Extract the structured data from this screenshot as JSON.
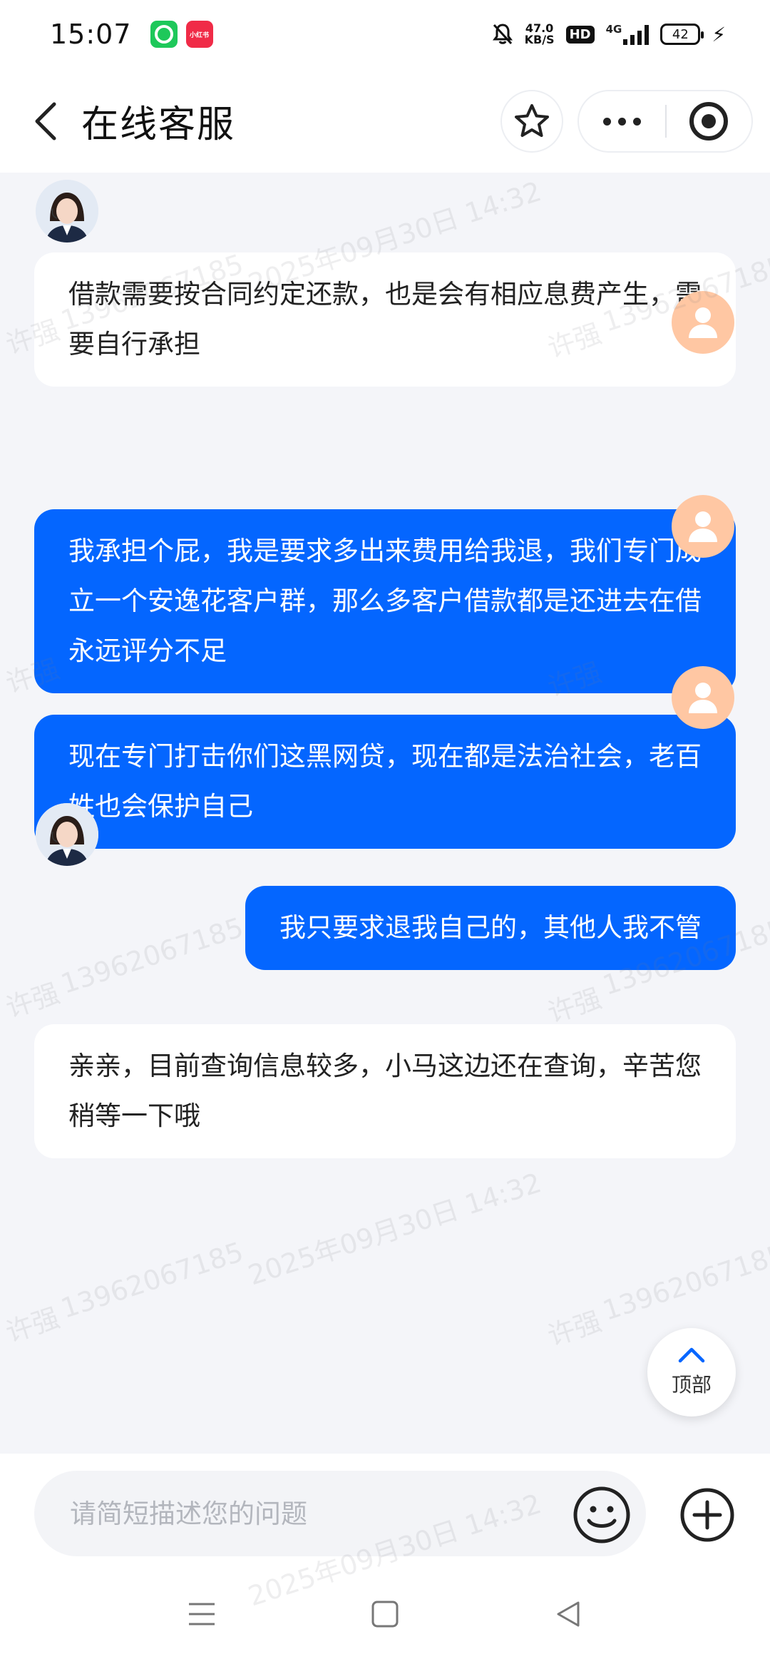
{
  "status_bar": {
    "time": "15:07",
    "app_badge_red": "小红书",
    "net_speed": "47.0",
    "net_unit": "KB/S",
    "hd": "HD",
    "network": "4G",
    "battery": "42"
  },
  "header": {
    "title": "在线客服"
  },
  "messages": [
    {
      "sender": "agent",
      "text": "借款需要按合同约定还款，也是会有相应息费产生，需要自行承担"
    },
    {
      "sender": "user",
      "text": "我承担个屁，我是要求多出来费用给我退，我们专门成立一个安逸花客户群，那么多客户借款都是还进去在借永远评分不足"
    },
    {
      "sender": "user",
      "text": "现在专门打击你们这黑网贷，现在都是法治社会，老百姓也会保护自己"
    },
    {
      "sender": "user",
      "text": "我只要求退我自己的，其他人我不管"
    },
    {
      "sender": "agent",
      "text": "亲亲，目前查询信息较多，小马这边还在查询，辛苦您稍等一下哦"
    }
  ],
  "top_button": {
    "label": "顶部"
  },
  "input": {
    "placeholder": "请简短描述您的问题"
  },
  "watermark": {
    "name": "许强",
    "phone": "13962067185",
    "datetime": "2025年09月30日 14:32"
  },
  "colors": {
    "user_bubble": "#0466ff",
    "agent_bubble": "#ffffff",
    "user_avatar": "#ffc7a3",
    "background": "#f4f5f9"
  }
}
